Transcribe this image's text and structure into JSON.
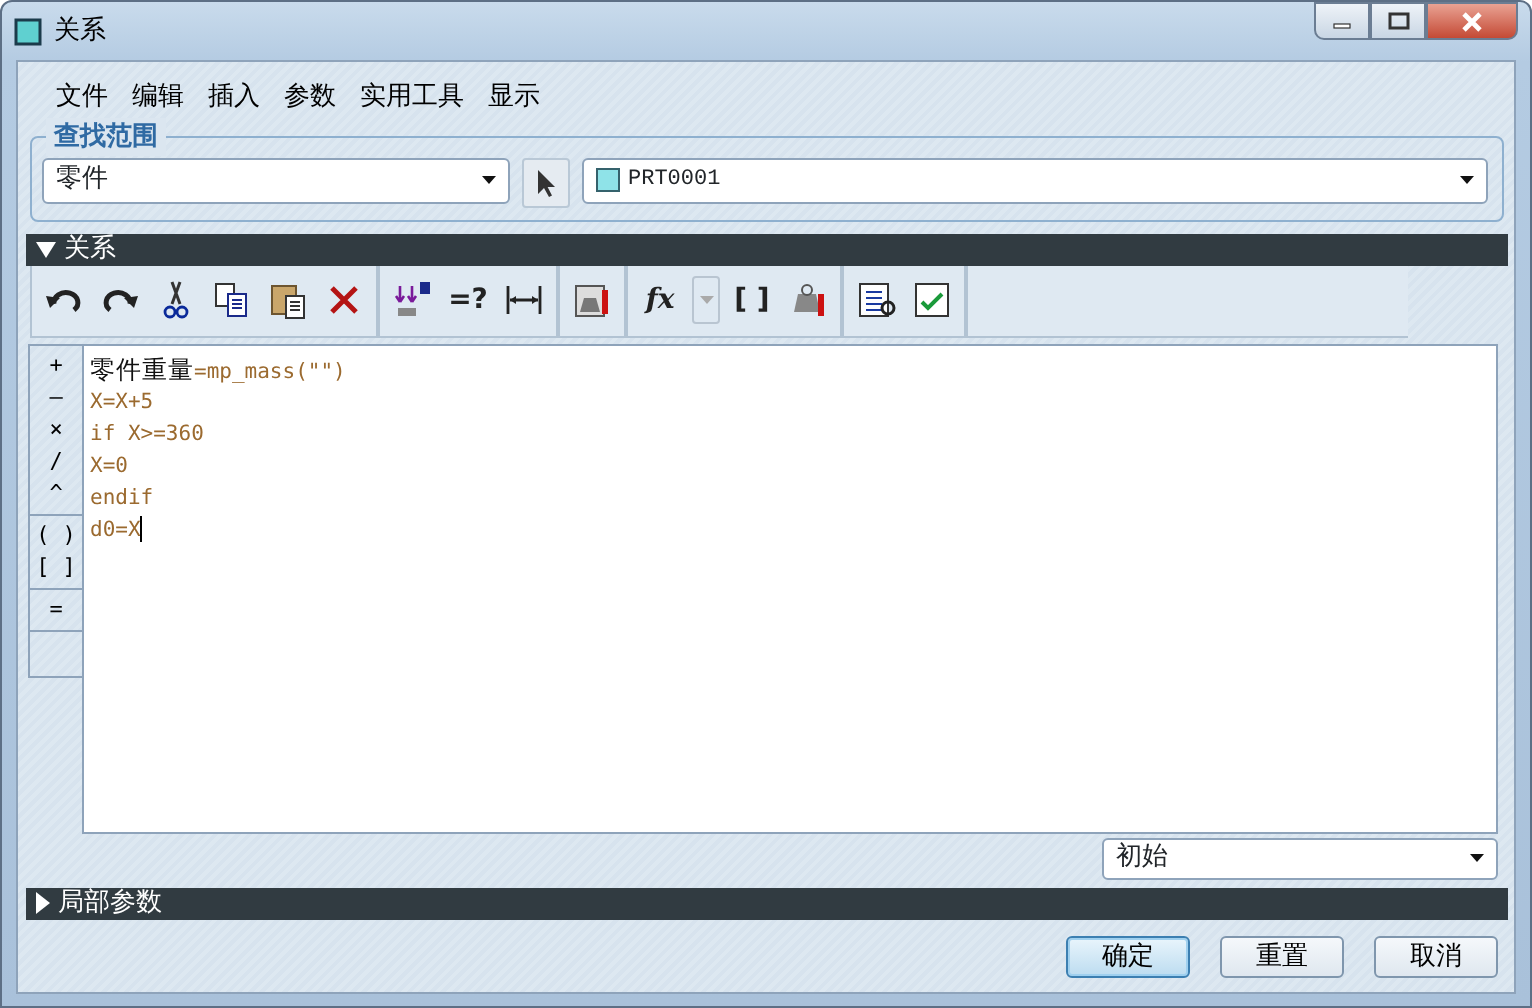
{
  "window": {
    "title": "关系"
  },
  "menu": [
    "文件",
    "编辑",
    "插入",
    "参数",
    "实用工具",
    "显示"
  ],
  "search_scope": {
    "title": "查找范围",
    "type_value": "零件",
    "object_value": "PRT0001"
  },
  "relations": {
    "title": "关系",
    "expanded": true,
    "toolbar_texts": [
      {
        "label": "=?"
      },
      {
        "label": "fx",
        "dropdown_disabled": true
      },
      {
        "label": "[ ]"
      }
    ],
    "operators": [
      [
        "+",
        "–",
        "×",
        "/",
        "^"
      ],
      [
        "( )",
        "[ ]"
      ],
      [
        "="
      ]
    ],
    "lines": [
      [
        {
          "text": "零件重量",
          "kind": "name"
        },
        {
          "text": "=mp_mass(\"\")",
          "kind": "code"
        }
      ],
      [
        {
          "text": "X=X+5",
          "kind": "code"
        }
      ],
      [
        {
          "text": "if X>=360",
          "kind": "code"
        }
      ],
      [
        {
          "text": "X=0",
          "kind": "code"
        }
      ],
      [
        {
          "text": "endif",
          "kind": "code"
        }
      ],
      [
        {
          "text": "d0=X",
          "kind": "code"
        }
      ]
    ],
    "filter_value": "初始"
  },
  "local_params": {
    "title": "局部参数",
    "expanded": false
  },
  "buttons": [
    {
      "label": "确定",
      "default": true
    },
    {
      "label": "重置",
      "default": false
    },
    {
      "label": "取消",
      "default": false
    }
  ]
}
